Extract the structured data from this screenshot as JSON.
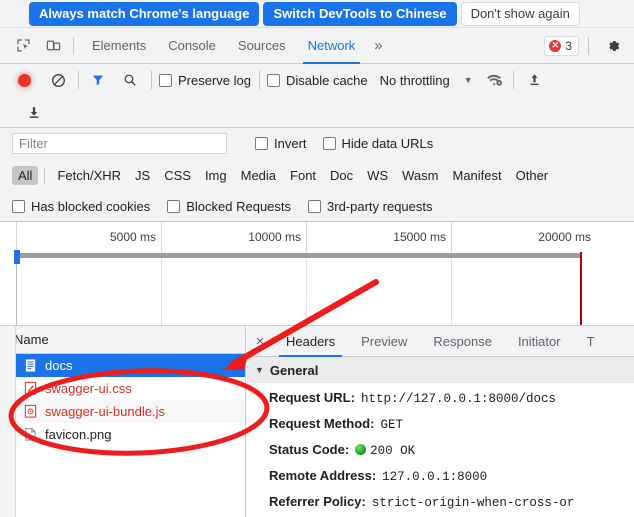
{
  "infobar": {
    "always_match": "Always match Chrome's language",
    "switch_devtools": "Switch DevTools to Chinese",
    "dont_show": "Don't show again"
  },
  "tabstrip": {
    "icons": [
      "inspect-element-icon",
      "device-toolbar-icon"
    ],
    "tabs": [
      {
        "label": "Elements",
        "active": false
      },
      {
        "label": "Console",
        "active": false
      },
      {
        "label": "Sources",
        "active": false
      },
      {
        "label": "Network",
        "active": true
      }
    ],
    "overflow": "»",
    "error_count": "3",
    "settings_icon": "gear-icon"
  },
  "network_toolbar": {
    "record_title": "record-button",
    "clear_title": "clear-button",
    "filter_title": "filter-toggle",
    "search_title": "search-button",
    "preserve_log": "Preserve log",
    "disable_cache": "Disable cache",
    "throttling": "No throttling",
    "throttle_caret": "▼",
    "wifi_icon": "network-conditions-icon",
    "upload_icon": "import-har-icon",
    "download_icon": "export-har-icon"
  },
  "filterbar": {
    "placeholder": "Filter",
    "value": "",
    "invert": "Invert",
    "hide_data_urls": "Hide data URLs",
    "types": [
      "All",
      "Fetch/XHR",
      "JS",
      "CSS",
      "Img",
      "Media",
      "Font",
      "Doc",
      "WS",
      "Wasm",
      "Manifest",
      "Other"
    ],
    "active_type": "All",
    "has_blocked_cookies": "Has blocked cookies",
    "blocked_requests": "Blocked Requests",
    "third_party": "3rd-party requests"
  },
  "overview": {
    "ticks": [
      "5000 ms",
      "10000 ms",
      "15000 ms",
      "20000 ms"
    ],
    "tick_values": [
      5000,
      10000,
      15000,
      20000
    ],
    "red_marker_ms": 20000
  },
  "request_list": {
    "column": "Name",
    "rows": [
      {
        "name": "docs",
        "icon": "document-icon",
        "state": "selected"
      },
      {
        "name": "swagger-ui.css",
        "icon": "stylesheet-icon",
        "state": "error"
      },
      {
        "name": "swagger-ui-bundle.js",
        "icon": "script-icon",
        "state": "error"
      },
      {
        "name": "favicon.png",
        "icon": "image-icon",
        "state": "normal"
      }
    ]
  },
  "details": {
    "close": "×",
    "tabs": [
      {
        "label": "Headers",
        "active": true
      },
      {
        "label": "Preview",
        "active": false
      },
      {
        "label": "Response",
        "active": false
      },
      {
        "label": "Initiator",
        "active": false
      },
      {
        "label": "T",
        "active": false
      }
    ],
    "section_title": "General",
    "section_caret": "▼",
    "general": [
      {
        "key": "Request URL:",
        "value": "http://127.0.0.1:8000/docs",
        "status": null
      },
      {
        "key": "Request Method:",
        "value": "GET",
        "status": null
      },
      {
        "key": "Status Code:",
        "value": "200 OK",
        "status": "ok"
      },
      {
        "key": "Remote Address:",
        "value": "127.0.0.1:8000",
        "status": null
      },
      {
        "key": "Referrer Policy:",
        "value": "strict-origin-when-cross-or",
        "status": null
      }
    ]
  },
  "annotations": {
    "arrow": "red-arrow-pointing-to-docs-row",
    "ellipse": "red-ellipse-around-request-rows"
  },
  "colors": {
    "accent_blue": "#1a73e8",
    "error_red": "#d93025",
    "record_red": "#e8342a",
    "annotation_red": "#ee1c1c",
    "status_green": "#0f9b0f",
    "toolbar_bg": "#f1f3f4"
  }
}
